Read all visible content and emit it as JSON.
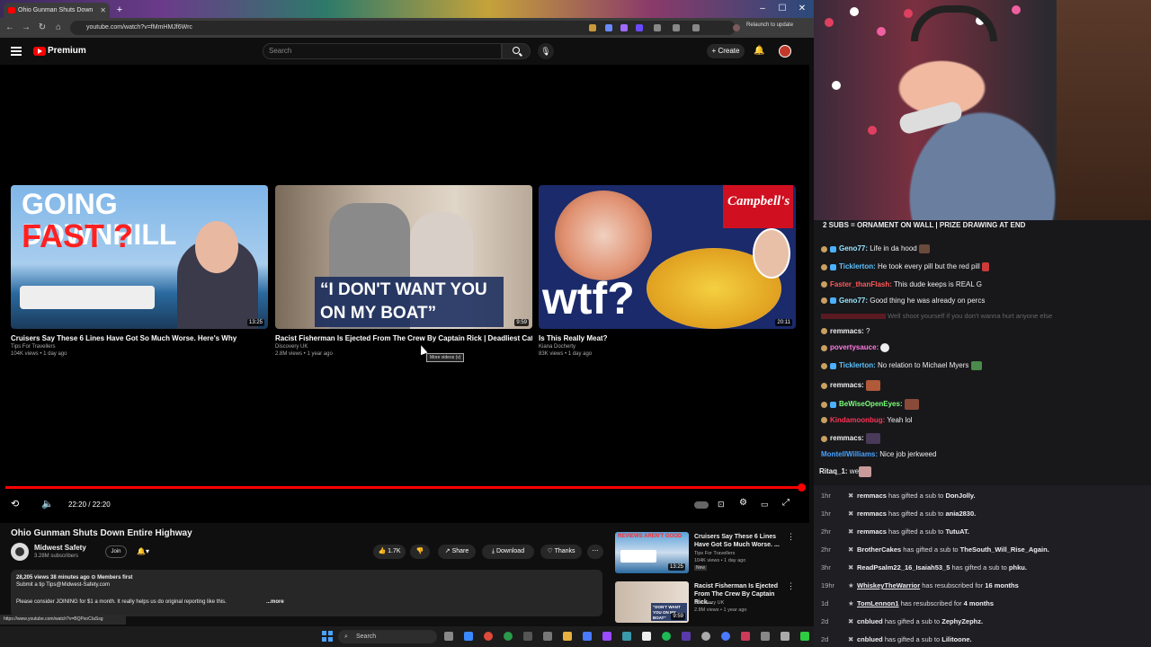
{
  "browser": {
    "tab_title": "Ohio Gunman Shuts Down",
    "url": "youtube.com/watch?v=fMmHMJf6Wrc",
    "relaunch_label": "Relaunch to update",
    "status_url": "https://www.youtube.com/watch?v=BQPsoCIaSsg"
  },
  "youtube": {
    "brand": "Premium",
    "search_placeholder": "Search",
    "create_label": "+ Create",
    "recommendations": [
      {
        "title": "Cruisers Say These 6 Lines Have Got So Much Worse. Here's Why",
        "channel": "Tips For Travellers",
        "meta": "104K views • 1 day ago",
        "duration": "13:25",
        "overlay_line1": "GOING DOWNHILL",
        "overlay_line2": "FAST ?"
      },
      {
        "title": "Racist Fisherman Is Ejected From The Crew By Captain Rick | Deadliest Catch",
        "channel": "Discovery UK",
        "meta": "2.8M views • 1 year ago",
        "duration": "9:59",
        "overlay_line1": "“I DON'T WANT YOU",
        "overlay_line2": "ON MY BOAT”"
      },
      {
        "title": "Is This Really Meat?",
        "channel": "Kiana Docherty",
        "meta": "83K views • 1 day ago",
        "duration": "20:11",
        "overlay_line1": "wtf?",
        "overlay_line2": "Campbell's"
      }
    ],
    "more_videos_tip": "More videos (v)",
    "player": {
      "time": "22:20 / 22:20",
      "progress_fraction": 1.0
    },
    "video": {
      "title": "Ohio Gunman Shuts Down Entire Highway",
      "channel": "Midwest Safety",
      "subscribers": "3.28M subscribers",
      "join_label": "Join",
      "like_count": "1.7K",
      "share_label": "Share",
      "download_label": "Download",
      "thanks_label": "Thanks",
      "desc_line1": "28,205 views  38 minutes ago  ⊙ Members first",
      "desc_line2": "Submit a tip Tips@Midwest-Safety.com",
      "desc_line3": "Please consider JOINING for $1 a month. It really helps us do original reporting like this.",
      "more_label": "...more"
    },
    "sidebar": [
      {
        "title": "Cruisers Say These 6 Lines Have Got So Much Worse. ...",
        "channel": "Tips For Travellers",
        "meta": "104K views • 1 day ago",
        "badge": "New",
        "duration": "13:25",
        "thumb_text": "REVIEWS AREN'T GOOD"
      },
      {
        "title": "Racist Fisherman Is Ejected From The Crew By Captain Rick...",
        "channel": "Discovery UK",
        "meta": "2.8M views • 1 year ago",
        "badge": "",
        "duration": "9:59",
        "thumb_text": "“DON'T WANT YOU ON MY BOAT”"
      }
    ]
  },
  "taskbar": {
    "search_label": "Search"
  },
  "chat": {
    "banner": "2 SUBS = ORNAMENT ON WALL | PRIZE DRAWING AT END",
    "messages": [
      {
        "user": "Geno77:",
        "text": "Life in da hood",
        "color": "#9be7ff"
      },
      {
        "user": "Ticklerton:",
        "text": "He took every pill but the red pill",
        "color": "#5dc4ff"
      },
      {
        "user": "Faster_thanFlash:",
        "text": "This dude keeps is REAL G",
        "color": "#ff5a5a"
      },
      {
        "user": "Geno77:",
        "text": "Good thing he was already on percs",
        "color": "#9be7ff"
      },
      {
        "user": "",
        "text": "Well shoot yourself if you don't wanna hurt anyone else",
        "color": "#777"
      },
      {
        "user": "remmacs:",
        "text": "?",
        "color": "#efeff1"
      },
      {
        "user": "povertysauce:",
        "text": "",
        "color": "#ff7ae0"
      },
      {
        "user": "Ticklerton:",
        "text": "No relation to Michael Myers",
        "color": "#5dc4ff"
      },
      {
        "user": "remmacs:",
        "text": "",
        "color": "#efeff1"
      },
      {
        "user": "BeWiseOpenEyes:",
        "text": "",
        "color": "#7aff7a"
      },
      {
        "user": "Kindamoonbug:",
        "text": "Yeah lol",
        "color": "#ff3355"
      },
      {
        "user": "remmacs:",
        "text": "",
        "color": "#efeff1"
      },
      {
        "user": "MontellWilliams:",
        "text": "Nice job jerkweed",
        "color": "#4aa3ff"
      },
      {
        "user": "Ritaq_1:",
        "text": "we",
        "color": "#efeff1"
      }
    ],
    "events": [
      {
        "time": "1hr",
        "user": "remmacs",
        "action": "has gifted a sub to",
        "target": "DonJolly."
      },
      {
        "time": "1hr",
        "user": "remmacs",
        "action": "has gifted a sub to",
        "target": "ania2830."
      },
      {
        "time": "2hr",
        "user": "remmacs",
        "action": "has gifted a sub to",
        "target": "TutuAT."
      },
      {
        "time": "2hr",
        "user": "BrotherCakes",
        "action": "has gifted a sub to",
        "target": "TheSouth_Will_Rise_Again."
      },
      {
        "time": "3hr",
        "user": "ReadPsalm22_16_Isaiah53_5",
        "action": "has gifted a sub to",
        "target": "phku."
      },
      {
        "time": "19hr",
        "user": "WhiskeyTheWarrior",
        "action": "has resubscribed for",
        "target": "16 months"
      },
      {
        "time": "1d",
        "user": "TomLennon1",
        "action": "has resubscribed for",
        "target": "4 months"
      },
      {
        "time": "2d",
        "user": "cnblued",
        "action": "has gifted a sub to",
        "target": "ZephyZephz."
      },
      {
        "time": "2d",
        "user": "cnblued",
        "action": "has gifted a sub to",
        "target": "Lilitoone."
      }
    ]
  },
  "colors": {
    "accent": "#ff0000",
    "bg": "#0f0f0f",
    "chat_bg": "#18181b"
  }
}
